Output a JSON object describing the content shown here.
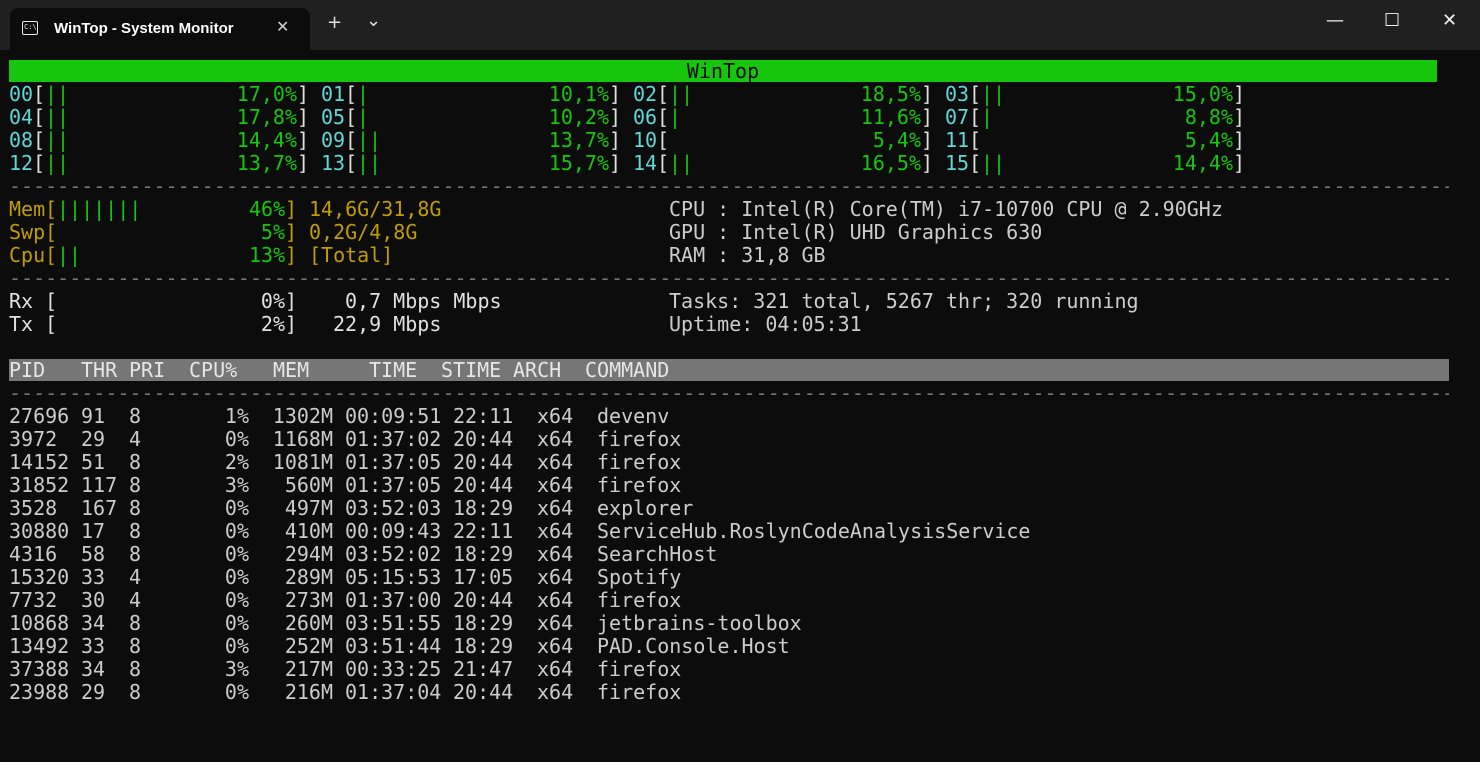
{
  "window": {
    "title": "WinTop - System Monitor",
    "tab_icon_text": "C:\\",
    "new_tab_symbol": "+",
    "dropdown_symbol": "⌄",
    "minimize_symbol": "—",
    "maximize_symbol": "☐",
    "close_symbol": "✕",
    "tab_close_symbol": "✕"
  },
  "banner": "WinTop",
  "cpus": [
    {
      "id": "00",
      "bar": "||",
      "pct": "17,0%"
    },
    {
      "id": "01",
      "bar": "|",
      "pct": "10,1%"
    },
    {
      "id": "02",
      "bar": "||",
      "pct": "18,5%"
    },
    {
      "id": "03",
      "bar": "||",
      "pct": "15,0%"
    },
    {
      "id": "04",
      "bar": "||",
      "pct": "17,8%"
    },
    {
      "id": "05",
      "bar": "|",
      "pct": "10,2%"
    },
    {
      "id": "06",
      "bar": "|",
      "pct": "11,6%"
    },
    {
      "id": "07",
      "bar": "|",
      "pct": "8,8%"
    },
    {
      "id": "08",
      "bar": "||",
      "pct": "14,4%"
    },
    {
      "id": "09",
      "bar": "||",
      "pct": "13,7%"
    },
    {
      "id": "10",
      "bar": "",
      "pct": "5,4%"
    },
    {
      "id": "11",
      "bar": "",
      "pct": "5,4%"
    },
    {
      "id": "12",
      "bar": "||",
      "pct": "13,7%"
    },
    {
      "id": "13",
      "bar": "||",
      "pct": "15,7%"
    },
    {
      "id": "14",
      "bar": "||",
      "pct": "16,5%"
    },
    {
      "id": "15",
      "bar": "||",
      "pct": "14,4%"
    }
  ],
  "separator": "------------------------------------------------------------------------------------------------------------------------",
  "meters": [
    {
      "label": "Mem",
      "bar": "|||||||",
      "pct": "46%",
      "value": "14,6G/31,8G"
    },
    {
      "label": "Swp",
      "bar": "",
      "pct": "5%",
      "value": "0,2G/4,8G"
    },
    {
      "label": "Cpu",
      "bar": "||",
      "pct": "13%",
      "value": "[Total]"
    }
  ],
  "sysinfo": [
    "CPU : Intel(R) Core(TM) i7-10700 CPU @ 2.90GHz",
    "GPU : Intel(R) UHD Graphics 630",
    "RAM : 31,8 GB"
  ],
  "network": [
    {
      "label": "Rx",
      "pct": "0%",
      "value": "0,7 Mbps Mbps"
    },
    {
      "label": "Tx",
      "pct": "2%",
      "value": "22,9 Mbps"
    }
  ],
  "tasks": "Tasks: 321 total, 5267 thr; 320 running",
  "uptime": "Uptime: 04:05:31",
  "columns": [
    "PID",
    "THR",
    "PRI",
    "CPU%",
    "MEM",
    "TIME",
    "STIME",
    "ARCH",
    "COMMAND"
  ],
  "processes": [
    {
      "pid": "27696",
      "thr": "91",
      "pri": "8",
      "cpu": "1%",
      "mem": "1302M",
      "time": "00:09:51",
      "stime": "22:11",
      "arch": "x64",
      "cmd": "devenv"
    },
    {
      "pid": "3972",
      "thr": "29",
      "pri": "4",
      "cpu": "0%",
      "mem": "1168M",
      "time": "01:37:02",
      "stime": "20:44",
      "arch": "x64",
      "cmd": "firefox"
    },
    {
      "pid": "14152",
      "thr": "51",
      "pri": "8",
      "cpu": "2%",
      "mem": "1081M",
      "time": "01:37:05",
      "stime": "20:44",
      "arch": "x64",
      "cmd": "firefox"
    },
    {
      "pid": "31852",
      "thr": "117",
      "pri": "8",
      "cpu": "3%",
      "mem": "560M",
      "time": "01:37:05",
      "stime": "20:44",
      "arch": "x64",
      "cmd": "firefox"
    },
    {
      "pid": "3528",
      "thr": "167",
      "pri": "8",
      "cpu": "0%",
      "mem": "497M",
      "time": "03:52:03",
      "stime": "18:29",
      "arch": "x64",
      "cmd": "explorer"
    },
    {
      "pid": "30880",
      "thr": "17",
      "pri": "8",
      "cpu": "0%",
      "mem": "410M",
      "time": "00:09:43",
      "stime": "22:11",
      "arch": "x64",
      "cmd": "ServiceHub.RoslynCodeAnalysisService"
    },
    {
      "pid": "4316",
      "thr": "58",
      "pri": "8",
      "cpu": "0%",
      "mem": "294M",
      "time": "03:52:02",
      "stime": "18:29",
      "arch": "x64",
      "cmd": "SearchHost"
    },
    {
      "pid": "15320",
      "thr": "33",
      "pri": "4",
      "cpu": "0%",
      "mem": "289M",
      "time": "05:15:53",
      "stime": "17:05",
      "arch": "x64",
      "cmd": "Spotify"
    },
    {
      "pid": "7732",
      "thr": "30",
      "pri": "4",
      "cpu": "0%",
      "mem": "273M",
      "time": "01:37:00",
      "stime": "20:44",
      "arch": "x64",
      "cmd": "firefox"
    },
    {
      "pid": "10868",
      "thr": "34",
      "pri": "8",
      "cpu": "0%",
      "mem": "260M",
      "time": "03:51:55",
      "stime": "18:29",
      "arch": "x64",
      "cmd": "jetbrains-toolbox"
    },
    {
      "pid": "13492",
      "thr": "33",
      "pri": "8",
      "cpu": "0%",
      "mem": "252M",
      "time": "03:51:44",
      "stime": "18:29",
      "arch": "x64",
      "cmd": "PAD.Console.Host"
    },
    {
      "pid": "37388",
      "thr": "34",
      "pri": "8",
      "cpu": "3%",
      "mem": "217M",
      "time": "00:33:25",
      "stime": "21:47",
      "arch": "x64",
      "cmd": "firefox"
    },
    {
      "pid": "23988",
      "thr": "29",
      "pri": "8",
      "cpu": "0%",
      "mem": "216M",
      "time": "01:37:04",
      "stime": "20:44",
      "arch": "x64",
      "cmd": "firefox"
    }
  ]
}
